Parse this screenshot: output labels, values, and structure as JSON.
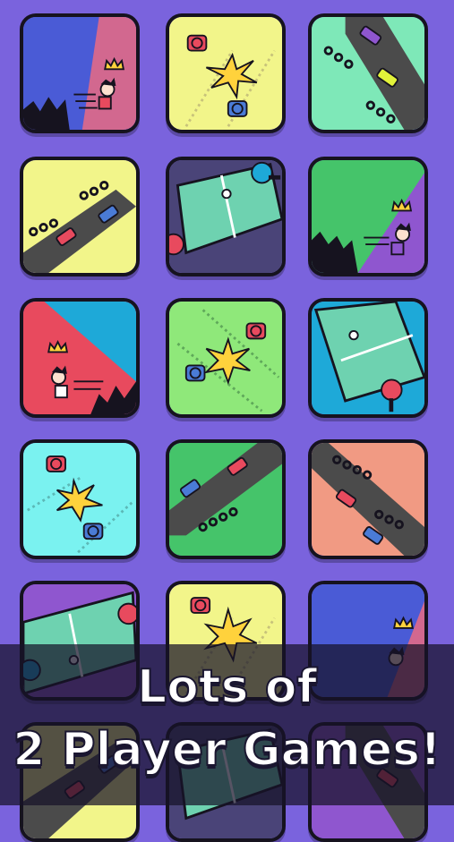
{
  "promo": {
    "line1": "Lots of",
    "line2": "2 Player Games!"
  },
  "colors": {
    "background": "#7a63dd",
    "tile_border": "#16131f",
    "blue": "#4a5bd6",
    "pink": "#d2688f",
    "yellow": "#f2f58a",
    "mint": "#7ee8b8",
    "lime": "#8fe87a",
    "cyan": "#7af2f0",
    "teal_blue": "#1ea9d8",
    "salmon": "#f19a83",
    "green": "#45c46a",
    "purple": "#8f56cf",
    "red": "#e84a5e"
  },
  "tiles": [
    {
      "game": "runner",
      "icon": "crown-icon"
    },
    {
      "game": "tank-battle",
      "icon": "star-icon"
    },
    {
      "game": "racing",
      "icon": "car-icon"
    },
    {
      "game": "racing",
      "icon": "car-icon"
    },
    {
      "game": "table-tennis",
      "icon": "paddle-icon"
    },
    {
      "game": "runner",
      "icon": "crown-icon"
    },
    {
      "game": "runner",
      "icon": "crown-icon"
    },
    {
      "game": "tank-battle",
      "icon": "star-icon"
    },
    {
      "game": "table-tennis",
      "icon": "paddle-icon"
    },
    {
      "game": "tank-battle",
      "icon": "star-icon"
    },
    {
      "game": "racing",
      "icon": "car-icon"
    },
    {
      "game": "racing",
      "icon": "car-icon"
    },
    {
      "game": "table-tennis",
      "icon": "paddle-icon"
    },
    {
      "game": "tank-battle",
      "icon": "star-icon"
    },
    {
      "game": "runner",
      "icon": "crown-icon"
    }
  ]
}
